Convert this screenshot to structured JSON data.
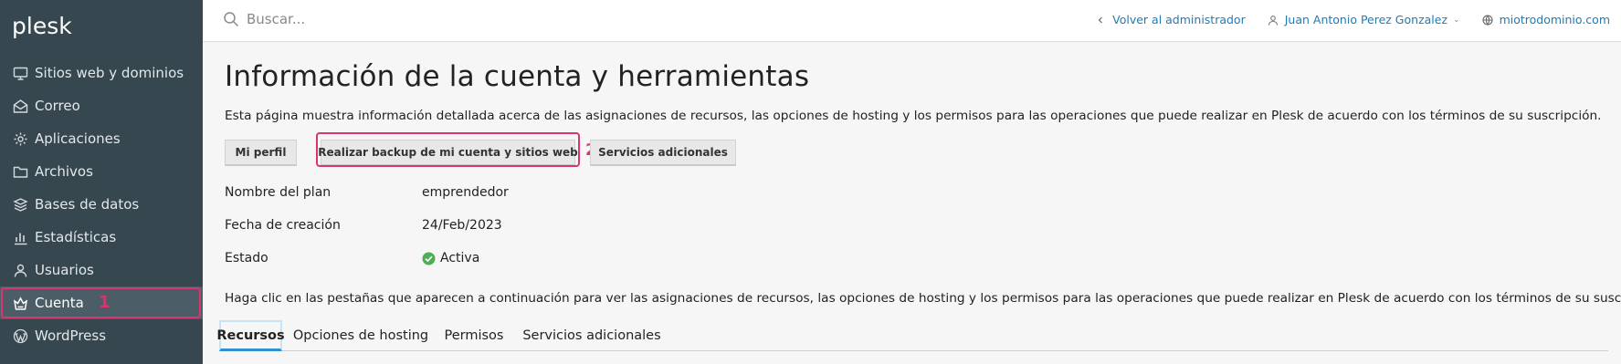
{
  "brand": {
    "logo_text": "plesk"
  },
  "sidebar": {
    "items": [
      {
        "label": "Sitios web y dominios",
        "icon": "monitor-icon"
      },
      {
        "label": "Correo",
        "icon": "mail-icon"
      },
      {
        "label": "Aplicaciones",
        "icon": "gear-icon"
      },
      {
        "label": "Archivos",
        "icon": "folder-icon"
      },
      {
        "label": "Bases de datos",
        "icon": "database-icon"
      },
      {
        "label": "Estadísticas",
        "icon": "bar-chart-icon"
      },
      {
        "label": "Usuarios",
        "icon": "user-icon"
      },
      {
        "label": "Cuenta",
        "icon": "account-icon",
        "active": true
      },
      {
        "label": "WordPress",
        "icon": "wordpress-icon"
      }
    ],
    "annotation_marker": "1"
  },
  "topbar": {
    "search_placeholder": "Buscar...",
    "back_label": "Volver al administrador",
    "user_label": "Juan Antonio Perez Gonzalez",
    "domain_label": "miotrodominio.com"
  },
  "main": {
    "title": "Información de la cuenta y herramientas",
    "description": "Esta página muestra información detallada acerca de las asignaciones de recursos, las opciones de hosting y los permisos para las operaciones que puede realizar en Plesk de acuerdo con los términos de su suscripción.",
    "buttons": {
      "profile": "Mi perfil",
      "backup": "Realizar backup de mi cuenta y sitios web",
      "services": "Servicios adicionales"
    },
    "annotation_marker": "2",
    "info": [
      {
        "key": "Nombre del plan",
        "value": "emprendedor"
      },
      {
        "key": "Fecha de creación",
        "value": "24/Feb/2023"
      },
      {
        "key": "Estado",
        "value": "Activa",
        "status_color": "#4caf50"
      }
    ],
    "tabs_description": "Haga clic en las pestañas que aparecen a continuación para ver las asignaciones de recursos, las opciones de hosting y los permisos para las operaciones que puede realizar en Plesk de acuerdo con los términos de su suscripción.",
    "tabs": [
      {
        "label": "Recursos",
        "active": true
      },
      {
        "label": "Opciones de hosting"
      },
      {
        "label": "Permisos"
      },
      {
        "label": "Servicios adicionales"
      }
    ]
  },
  "colors": {
    "sidebar_bg": "#36474f",
    "link": "#1f7bb6",
    "highlight": "#d9356e"
  }
}
